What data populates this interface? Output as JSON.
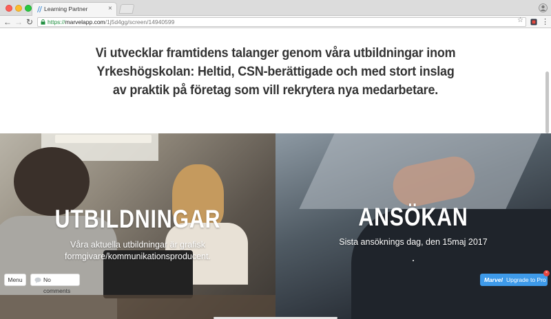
{
  "browser": {
    "tab_title": "Learning Partner",
    "tab_close": "×",
    "url_secure_prefix": "https://",
    "url_host": "marvelapp.com",
    "url_path": "/1j5d4gg/screen/14940599",
    "nav_back": "←",
    "nav_forward": "→",
    "nav_reload": "↻",
    "star": "☆",
    "menu": "⋮"
  },
  "hero": {
    "text": "Vi utvecklar framtidens talanger genom våra utbildningar inom Yrkeshögskolan: Heltid, CSN-berättigade och med stort inslag av praktik på företag som vill rekrytera nya medarbetare."
  },
  "panels": {
    "left": {
      "title": "UTBILDNINGAR",
      "subtitle": "Våra aktuella utbildningar är grafisk formgivare/kommunikationsproducent."
    },
    "right": {
      "title": "ANSÖKAN",
      "subtitle": "Sista ansöknings dag, den 15maj 2017"
    }
  },
  "marvel": {
    "menu_label": "Menu",
    "comments_label": "No comments",
    "logo_text": "Marvel",
    "upgrade_label": "Upgrade to Pro",
    "notification": "×"
  },
  "colors": {
    "accent": "#3e9ae9",
    "secure": "#1e8e3e",
    "heading": "#333333"
  },
  "icons": {
    "favicon": "learning-partner-favicon",
    "lock": "lock-icon",
    "star": "star-icon",
    "profile": "profile-icon",
    "comment": "comment-icon"
  }
}
